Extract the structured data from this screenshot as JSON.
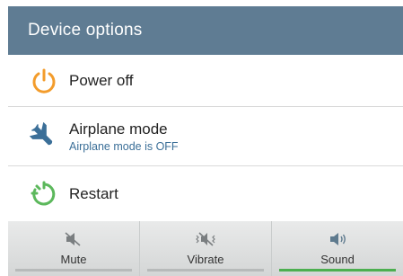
{
  "header": {
    "title": "Device options"
  },
  "options": [
    {
      "label": "Power off",
      "icon": "power-icon"
    },
    {
      "label": "Airplane mode",
      "sub": "Airplane mode is OFF",
      "icon": "airplane-icon"
    },
    {
      "label": "Restart",
      "icon": "restart-icon"
    }
  ],
  "sound_profiles": [
    {
      "label": "Mute",
      "icon": "mute-icon",
      "active": false
    },
    {
      "label": "Vibrate",
      "icon": "vibrate-icon",
      "active": false
    },
    {
      "label": "Sound",
      "icon": "sound-icon",
      "active": true
    }
  ],
  "colors": {
    "header_bg": "#5f7c93",
    "power_orange": "#f39c2b",
    "airplane_blue": "#3b6f98",
    "restart_green": "#5cb85c",
    "active_indicator": "#4caf50"
  }
}
